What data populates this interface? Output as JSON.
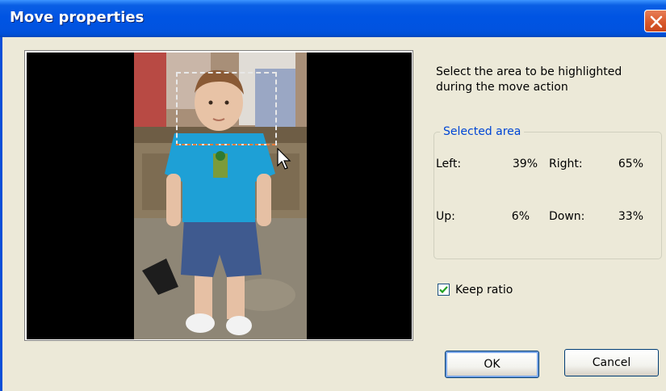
{
  "window": {
    "title": "Move properties"
  },
  "instruction": "Select the area to be highlighted during the move action",
  "selected_area": {
    "title": "Selected area",
    "left_label": "Left:",
    "left_value": "39%",
    "right_label": "Right:",
    "right_value": "65%",
    "up_label": "Up:",
    "up_value": "6%",
    "down_label": "Down:",
    "down_value": "33%"
  },
  "keep_ratio": {
    "label": "Keep ratio",
    "checked": true
  },
  "buttons": {
    "ok": "OK",
    "cancel": "Cancel"
  },
  "colors": {
    "titlebar": "#0054e3",
    "dialog_bg": "#ece9d8",
    "group_label": "#0046d5",
    "close_button": "#d95a2c"
  },
  "icons": {
    "close": "close-icon",
    "cursor": "mouse-pointer-icon",
    "check": "checkmark-icon"
  }
}
